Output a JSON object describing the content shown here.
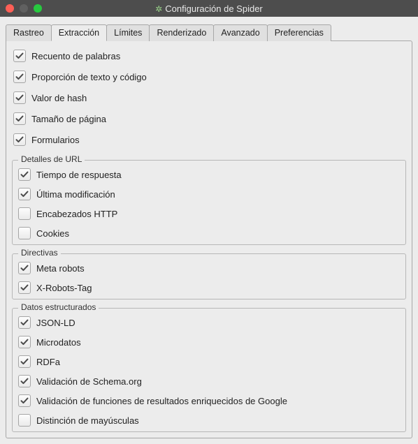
{
  "window": {
    "title": "Configuración de Spider"
  },
  "tabs": {
    "items": [
      {
        "label": "Rastreo"
      },
      {
        "label": "Extracción"
      },
      {
        "label": "Límites"
      },
      {
        "label": "Renderizado"
      },
      {
        "label": "Avanzado"
      },
      {
        "label": "Preferencias"
      }
    ],
    "activeIndex": 1
  },
  "top_items": [
    {
      "label": "Recuento de palabras",
      "checked": true
    },
    {
      "label": "Proporción de texto y código",
      "checked": true
    },
    {
      "label": "Valor de hash",
      "checked": true
    },
    {
      "label": "Tamaño de página",
      "checked": true
    },
    {
      "label": "Formularios",
      "checked": true
    }
  ],
  "groups": [
    {
      "legend": "Detalles de URL",
      "items": [
        {
          "label": "Tiempo de respuesta",
          "checked": true
        },
        {
          "label": "Última modificación",
          "checked": true
        },
        {
          "label": "Encabezados HTTP",
          "checked": false
        },
        {
          "label": "Cookies",
          "checked": false
        }
      ]
    },
    {
      "legend": "Directivas",
      "items": [
        {
          "label": "Meta robots",
          "checked": true
        },
        {
          "label": "X-Robots-Tag",
          "checked": true
        }
      ]
    },
    {
      "legend": "Datos estructurados",
      "items": [
        {
          "label": "JSON-LD",
          "checked": true
        },
        {
          "label": "Microdatos",
          "checked": true
        },
        {
          "label": "RDFa",
          "checked": true
        },
        {
          "label": "Validación de Schema.org",
          "checked": true
        },
        {
          "label": "Validación de funciones de resultados enriquecidos de Google",
          "checked": true
        },
        {
          "label": "Distinción de mayúsculas",
          "checked": false
        }
      ]
    }
  ]
}
